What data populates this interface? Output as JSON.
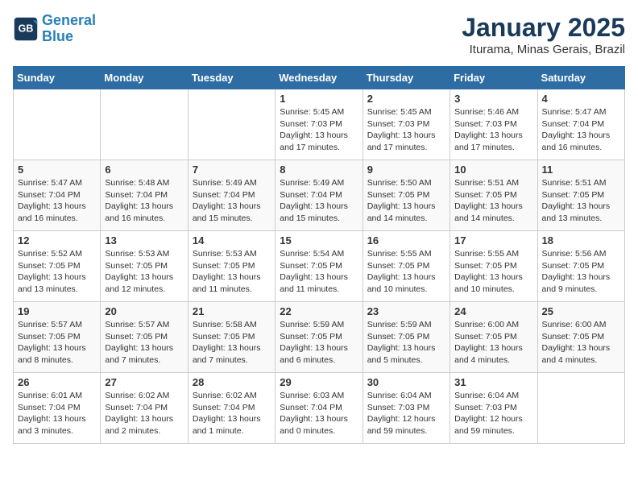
{
  "logo": {
    "line1": "General",
    "line2": "Blue"
  },
  "title": "January 2025",
  "location": "Iturama, Minas Gerais, Brazil",
  "weekdays": [
    "Sunday",
    "Monday",
    "Tuesday",
    "Wednesday",
    "Thursday",
    "Friday",
    "Saturday"
  ],
  "weeks": [
    [
      {
        "day": "",
        "info": ""
      },
      {
        "day": "",
        "info": ""
      },
      {
        "day": "",
        "info": ""
      },
      {
        "day": "1",
        "info": "Sunrise: 5:45 AM\nSunset: 7:03 PM\nDaylight: 13 hours\nand 17 minutes."
      },
      {
        "day": "2",
        "info": "Sunrise: 5:45 AM\nSunset: 7:03 PM\nDaylight: 13 hours\nand 17 minutes."
      },
      {
        "day": "3",
        "info": "Sunrise: 5:46 AM\nSunset: 7:03 PM\nDaylight: 13 hours\nand 17 minutes."
      },
      {
        "day": "4",
        "info": "Sunrise: 5:47 AM\nSunset: 7:04 PM\nDaylight: 13 hours\nand 16 minutes."
      }
    ],
    [
      {
        "day": "5",
        "info": "Sunrise: 5:47 AM\nSunset: 7:04 PM\nDaylight: 13 hours\nand 16 minutes."
      },
      {
        "day": "6",
        "info": "Sunrise: 5:48 AM\nSunset: 7:04 PM\nDaylight: 13 hours\nand 16 minutes."
      },
      {
        "day": "7",
        "info": "Sunrise: 5:49 AM\nSunset: 7:04 PM\nDaylight: 13 hours\nand 15 minutes."
      },
      {
        "day": "8",
        "info": "Sunrise: 5:49 AM\nSunset: 7:04 PM\nDaylight: 13 hours\nand 15 minutes."
      },
      {
        "day": "9",
        "info": "Sunrise: 5:50 AM\nSunset: 7:05 PM\nDaylight: 13 hours\nand 14 minutes."
      },
      {
        "day": "10",
        "info": "Sunrise: 5:51 AM\nSunset: 7:05 PM\nDaylight: 13 hours\nand 14 minutes."
      },
      {
        "day": "11",
        "info": "Sunrise: 5:51 AM\nSunset: 7:05 PM\nDaylight: 13 hours\nand 13 minutes."
      }
    ],
    [
      {
        "day": "12",
        "info": "Sunrise: 5:52 AM\nSunset: 7:05 PM\nDaylight: 13 hours\nand 13 minutes."
      },
      {
        "day": "13",
        "info": "Sunrise: 5:53 AM\nSunset: 7:05 PM\nDaylight: 13 hours\nand 12 minutes."
      },
      {
        "day": "14",
        "info": "Sunrise: 5:53 AM\nSunset: 7:05 PM\nDaylight: 13 hours\nand 11 minutes."
      },
      {
        "day": "15",
        "info": "Sunrise: 5:54 AM\nSunset: 7:05 PM\nDaylight: 13 hours\nand 11 minutes."
      },
      {
        "day": "16",
        "info": "Sunrise: 5:55 AM\nSunset: 7:05 PM\nDaylight: 13 hours\nand 10 minutes."
      },
      {
        "day": "17",
        "info": "Sunrise: 5:55 AM\nSunset: 7:05 PM\nDaylight: 13 hours\nand 10 minutes."
      },
      {
        "day": "18",
        "info": "Sunrise: 5:56 AM\nSunset: 7:05 PM\nDaylight: 13 hours\nand 9 minutes."
      }
    ],
    [
      {
        "day": "19",
        "info": "Sunrise: 5:57 AM\nSunset: 7:05 PM\nDaylight: 13 hours\nand 8 minutes."
      },
      {
        "day": "20",
        "info": "Sunrise: 5:57 AM\nSunset: 7:05 PM\nDaylight: 13 hours\nand 7 minutes."
      },
      {
        "day": "21",
        "info": "Sunrise: 5:58 AM\nSunset: 7:05 PM\nDaylight: 13 hours\nand 7 minutes."
      },
      {
        "day": "22",
        "info": "Sunrise: 5:59 AM\nSunset: 7:05 PM\nDaylight: 13 hours\nand 6 minutes."
      },
      {
        "day": "23",
        "info": "Sunrise: 5:59 AM\nSunset: 7:05 PM\nDaylight: 13 hours\nand 5 minutes."
      },
      {
        "day": "24",
        "info": "Sunrise: 6:00 AM\nSunset: 7:05 PM\nDaylight: 13 hours\nand 4 minutes."
      },
      {
        "day": "25",
        "info": "Sunrise: 6:00 AM\nSunset: 7:05 PM\nDaylight: 13 hours\nand 4 minutes."
      }
    ],
    [
      {
        "day": "26",
        "info": "Sunrise: 6:01 AM\nSunset: 7:04 PM\nDaylight: 13 hours\nand 3 minutes."
      },
      {
        "day": "27",
        "info": "Sunrise: 6:02 AM\nSunset: 7:04 PM\nDaylight: 13 hours\nand 2 minutes."
      },
      {
        "day": "28",
        "info": "Sunrise: 6:02 AM\nSunset: 7:04 PM\nDaylight: 13 hours\nand 1 minute."
      },
      {
        "day": "29",
        "info": "Sunrise: 6:03 AM\nSunset: 7:04 PM\nDaylight: 13 hours\nand 0 minutes."
      },
      {
        "day": "30",
        "info": "Sunrise: 6:04 AM\nSunset: 7:03 PM\nDaylight: 12 hours\nand 59 minutes."
      },
      {
        "day": "31",
        "info": "Sunrise: 6:04 AM\nSunset: 7:03 PM\nDaylight: 12 hours\nand 59 minutes."
      },
      {
        "day": "",
        "info": ""
      }
    ]
  ]
}
